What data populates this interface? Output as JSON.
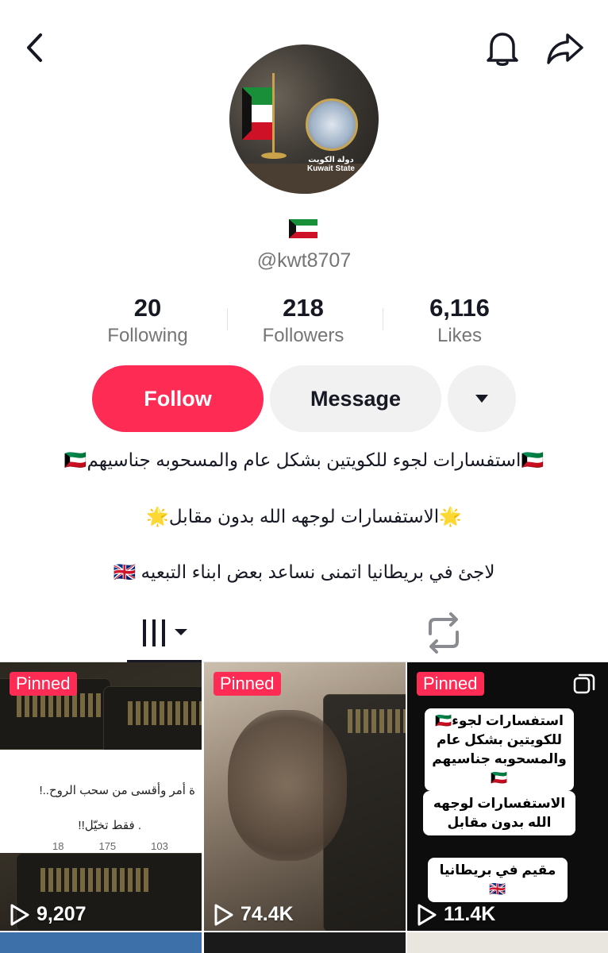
{
  "header": {
    "back_icon": "chevron-left-icon",
    "bell_icon": "bell-icon",
    "share_icon": "share-arrow-icon"
  },
  "profile": {
    "avatar_text": "دولة الكويت\nKuwait State",
    "flag_emoji": "🇰🇼",
    "username": "@kwt8707"
  },
  "stats": [
    {
      "value": "20",
      "label": "Following"
    },
    {
      "value": "218",
      "label": "Followers"
    },
    {
      "value": "6,116",
      "label": "Likes"
    }
  ],
  "actions": {
    "follow": "Follow",
    "message": "Message",
    "more_icon": "caret-down-icon"
  },
  "bio": [
    "🇰🇼استفسارات لجوء للكويتين بشكل عام والمسحوبه جناسيهم🇰🇼",
    "🌟الاستفسارات لوجهه الله بدون مقابل🌟",
    "لاجئ في بريطانيا اتمنى نساعد بعض ابناء التبعيه 🇬🇧"
  ],
  "tabs": {
    "videos_icon": "grid-bars-icon",
    "reposts_icon": "repost-icon"
  },
  "videos": [
    {
      "pinned": "Pinned",
      "views": "9,207",
      "overlay_line1": "ة أمر وأقسى من سحب الروح..!",
      "overlay_line2": ". فقط تخيّل!!",
      "overlay_stats": [
        "18",
        "175",
        "103"
      ]
    },
    {
      "pinned": "Pinned",
      "views": "74.4K"
    },
    {
      "pinned": "Pinned",
      "views": "11.4K",
      "note1": "استفسارات لجوء🇰🇼 للكويتين بشكل عام والمسحوبه جناسيهم🇰🇼",
      "note2": "الاستفسارات لوجهه الله بدون مقابل",
      "note3": "مقيم في بريطانيا🇬🇧"
    }
  ],
  "colors": {
    "accent": "#fe2c55",
    "secondary_bg": "#f1f1f2",
    "muted_text": "#757575"
  }
}
